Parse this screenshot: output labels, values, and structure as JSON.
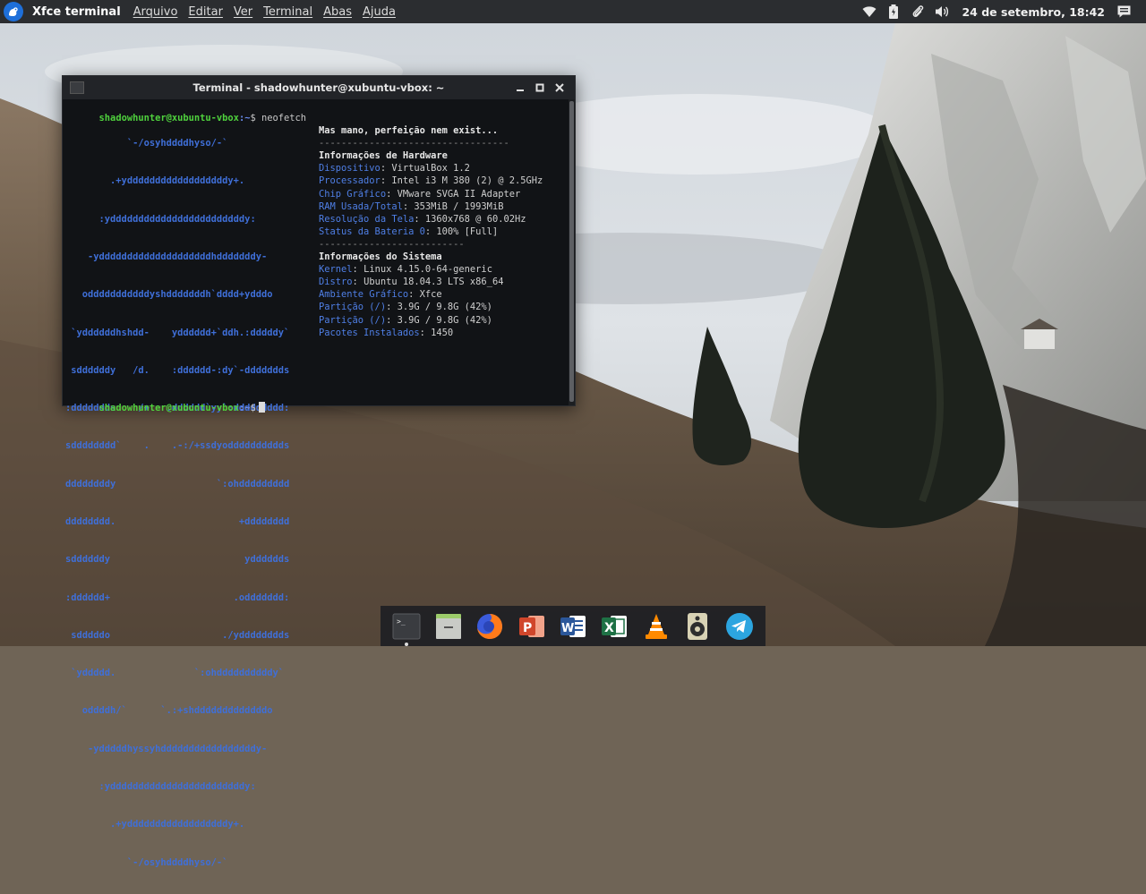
{
  "top_panel": {
    "app_title": "Xfce terminal",
    "menu": [
      "Arquivo",
      "Editar",
      "Ver",
      "Terminal",
      "Abas",
      "Ajuda"
    ],
    "clock": "24 de setembro, 18:42",
    "tray_icons": [
      "wifi-icon",
      "battery-icon",
      "clip-icon",
      "volume-icon",
      "notifications-icon"
    ]
  },
  "terminal": {
    "title": "Terminal - shadowhunter@xubuntu-vbox: ~",
    "buttons": [
      "minimize",
      "maximize",
      "close"
    ],
    "prompt_user": "shadowhunter@xubuntu-vbox",
    "prompt_path": ":~",
    "prompt_symbol": "$",
    "command": "neofetch",
    "logo_lines": [
      "           `-/osyhddddhyso/-`",
      "        .+yddddddddddddddddddy+.",
      "      :yddddddddddddddddddddddddy:",
      "    -yddddddddddddddddddddhdddddddy-",
      "   odddddddddddyshdddddddh`dddd+ydddo",
      " `yddddddhshdd-    ydddddd+`ddh.:dddddy`",
      " sddddddy   /d.    :dddddd-:dy`-ddddddds",
      ":ddddddds    /+   .dddddd`yy`:ddddddddd:",
      "sdddddddd`    .    .-:/+ssdyodddddddddds",
      "ddddddddy                  `:ohddddddddd",
      "dddddddd.                      +dddddddd",
      "sddddddy                        ydddddds",
      ":dddddd+                      .oddddddd:",
      " sdddddo                    ./ydddddddds",
      " `yddddd.              `:ohddddddddddy`",
      "   oddddh/`      `.:+shdddddddddddddo",
      "    -ydddddhyssyhdddddddddddddddddy-",
      "      :yddddddddddddddddddddddddy:",
      "        .+yddddddddddddddddddy+.",
      "           `-/osyhddddhyso/-`"
    ],
    "info": {
      "motto": "Mas mano, perfeição nem exist...",
      "separator_long": "----------------------------------",
      "hardware_header": "Informações de Hardware",
      "hardware": [
        {
          "key": "Dispositivo",
          "value": "VirtualBox 1.2"
        },
        {
          "key": "Processador",
          "value": "Intel i3 M 380 (2) @ 2.5GHz"
        },
        {
          "key": "Chip Gráfico",
          "value": "VMware SVGA II Adapter"
        },
        {
          "key": "RAM Usada/Total",
          "value": "353MiB / 1993MiB"
        },
        {
          "key": "Resolução da Tela",
          "value": "1360x768 @ 60.02Hz"
        },
        {
          "key": "Status da Bateria 0",
          "value": "100% [Full]"
        }
      ],
      "separator_short": "--------------------------",
      "system_header": "Informações do Sistema",
      "system": [
        {
          "key": "Kernel",
          "value": "Linux 4.15.0-64-generic"
        },
        {
          "key": "Distro",
          "value": "Ubuntu 18.04.3 LTS x86_64"
        },
        {
          "key": "Ambiente Gráfico",
          "value": "Xfce"
        },
        {
          "key": "Partição (/)",
          "value": "3.9G / 9.8G (42%)"
        },
        {
          "key": "Partição (/)",
          "value": "3.9G / 9.8G (42%)"
        },
        {
          "key": "Pacotes Instalados",
          "value": "1450"
        }
      ]
    }
  },
  "dock": {
    "items": [
      "terminal-icon",
      "file-manager-icon",
      "firefox-icon",
      "powerpoint-icon",
      "word-icon",
      "excel-icon",
      "vlc-icon",
      "audio-player-icon",
      "telegram-icon"
    ]
  }
}
